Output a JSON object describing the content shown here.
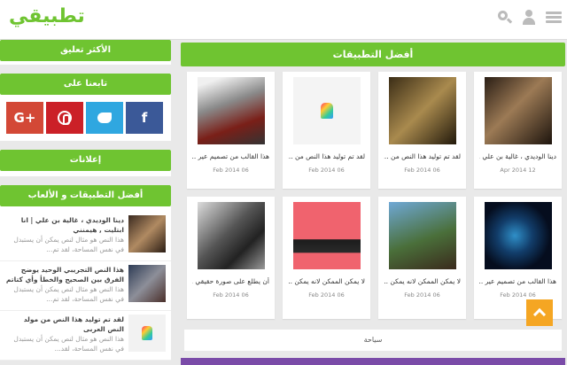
{
  "header": {
    "logo": "تطبيقي",
    "icons": [
      "menu-icon",
      "user-icon",
      "search-icon"
    ]
  },
  "sidebar": {
    "most_commented_title": "الأكثر تعليق",
    "follow_title": "تابعنا على",
    "social": [
      {
        "name": "google-plus",
        "label": "G+",
        "color": "#d34836"
      },
      {
        "name": "pinterest",
        "label": "",
        "color": "#cb2027"
      },
      {
        "name": "twitter",
        "label": "",
        "color": "#2fa7e0"
      },
      {
        "name": "facebook",
        "label": "f",
        "color": "#3b5998"
      }
    ],
    "ads_title": "إعلانات",
    "apps_games_title": "أفضل التطبيقات و الألعاب",
    "items": [
      {
        "title": "دينا الوديدي ، غالية بن علي | انا ابتليت , هيمنني",
        "excerpt": "هذا النص هو مثال لنص يمكن أن يستبدل في نفس المساحة، لقد تم..."
      },
      {
        "title": "هذا النص التجريبي الوحيد يوضح الفرق بين الصحيح والخطأ وأي كتاتم",
        "excerpt": "هذا النص هو مثال لنص يمكن أن يستبدل في نفس المساحة، لقد تم..."
      },
      {
        "title": "لقد تم توليد هذا النص من مولد النص العربى",
        "excerpt": "هذا النص هو مثال لنص يمكن أن يستبدل في نفس المساحة، لقد..."
      }
    ]
  },
  "main": {
    "title": "أفضل التطبيقات",
    "cards": [
      {
        "title": "دينا الوديدي ، غالية بن علي ...",
        "date": "12 Apr 2014"
      },
      {
        "title": "لقد تم توليد هذا النص من ...",
        "date": "06 Feb 2014"
      },
      {
        "title": "لقد تم توليد هذا النص من ...",
        "date": "06 Feb 2014"
      },
      {
        "title": "هذا القالب من تصميم عير ...",
        "date": "06 Feb 2014"
      },
      {
        "title": "هذا القالب من تصميم عير ...",
        "date": "06 Feb 2014"
      },
      {
        "title": "لا يمكن الممكن لانه يمكن ...",
        "date": "06 Feb 2014"
      },
      {
        "title": "لا يمكن الممكن لانه يمكن ...",
        "date": "06 Feb 2014"
      },
      {
        "title": "أن يطلع على صورة حقيقي ...",
        "date": "06 Feb 2014"
      }
    ],
    "more_label": "سياحة"
  },
  "colors": {
    "accent": "#6fc431",
    "scroll_top": "#f5a623",
    "purple_bar": "#7a4ba8"
  }
}
